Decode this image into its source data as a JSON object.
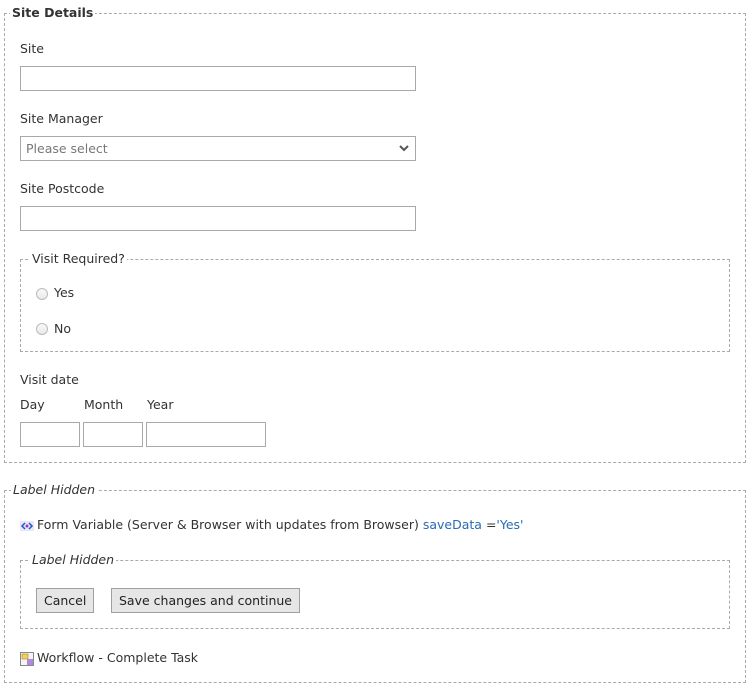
{
  "site_details": {
    "legend": "Site Details",
    "site": {
      "label": "Site",
      "value": ""
    },
    "site_manager": {
      "label": "Site Manager",
      "selected": "Please select"
    },
    "site_postcode": {
      "label": "Site Postcode",
      "value": ""
    },
    "visit_required": {
      "legend": "Visit Required?",
      "options": [
        {
          "label": "Yes",
          "checked": false
        },
        {
          "label": "No",
          "checked": false
        }
      ]
    },
    "visit_date": {
      "label": "Visit date",
      "day_label": "Day",
      "month_label": "Month",
      "year_label": "Year",
      "day": "",
      "month": "",
      "year": ""
    }
  },
  "hidden_section": {
    "legend": "Label Hidden",
    "form_variable": {
      "icon": "form-variable-icon",
      "text": "Form Variable (Server & Browser with updates from Browser)",
      "name": "saveData",
      "equals": "=",
      "value": "'Yes'"
    },
    "inner": {
      "legend": "Label Hidden",
      "cancel_label": "Cancel",
      "save_label": "Save changes and continue"
    },
    "workflow": {
      "icon": "workflow-icon",
      "text": "Workflow - Complete Task"
    }
  },
  "colors": {
    "border": "#aaaaaa",
    "link": "#2a6ab3",
    "button_bg": "#e6e6e6"
  }
}
